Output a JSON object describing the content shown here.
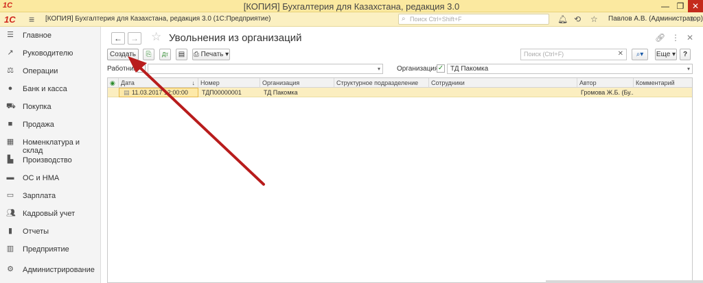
{
  "window": {
    "title": "[КОПИЯ] Бухгалтерия для Казахстана, редакция 3.0"
  },
  "appbar": {
    "logo": "1С",
    "title": "[КОПИЯ] Бухгалтерия для Казахстана, редакция 3.0  (1С:Предприятие)",
    "search_placeholder": "Поиск Ctrl+Shift+F",
    "user": "Павлов А.В. (Администратор)"
  },
  "sidebar": {
    "items": [
      {
        "label": "Главное",
        "icon": "menu-icon"
      },
      {
        "label": "Руководителю",
        "icon": "chart-line-icon"
      },
      {
        "label": "Операции",
        "icon": "operations-icon"
      },
      {
        "label": "Банк и касса",
        "icon": "bank-icon"
      },
      {
        "label": "Покупка",
        "icon": "cart-icon"
      },
      {
        "label": "Продажа",
        "icon": "bag-icon"
      },
      {
        "label": "Номенклатура и склад",
        "icon": "warehouse-icon"
      },
      {
        "label": "Производство",
        "icon": "factory-icon"
      },
      {
        "label": "ОС и НМА",
        "icon": "truck-icon"
      },
      {
        "label": "Зарплата",
        "icon": "money-icon"
      },
      {
        "label": "Кадровый учет",
        "icon": "people-icon"
      },
      {
        "label": "Отчеты",
        "icon": "report-icon"
      },
      {
        "label": "Предприятие",
        "icon": "building-icon"
      },
      {
        "label": "Администрирование",
        "icon": "gear-icon"
      }
    ]
  },
  "page": {
    "title": "Увольнения из организаций"
  },
  "toolbar": {
    "create": "Создать",
    "print": "Печать",
    "search_placeholder": "Поиск (Ctrl+F)",
    "more": "Еще",
    "help": "?"
  },
  "filters": {
    "employee_label": "Работник:",
    "org_label": "Организация:",
    "org_value": "ТД Пакомка"
  },
  "table": {
    "columns": [
      "Дата",
      "Номер",
      "Организация",
      "Структурное подразделение",
      "Сотрудники",
      "Автор",
      "Комментарий"
    ],
    "rows": [
      {
        "date": "11.03.2017 12:00:00",
        "number": "ТДП00000001",
        "org": "ТД Пакомка",
        "dept": "",
        "employees": "",
        "author": "Громова Ж.Б. (Бу...",
        "comment": ""
      }
    ]
  },
  "colors": {
    "accent_header": "#fbe9a0",
    "selected_row": "#fbeec0",
    "arrow": "#b81c1c"
  }
}
